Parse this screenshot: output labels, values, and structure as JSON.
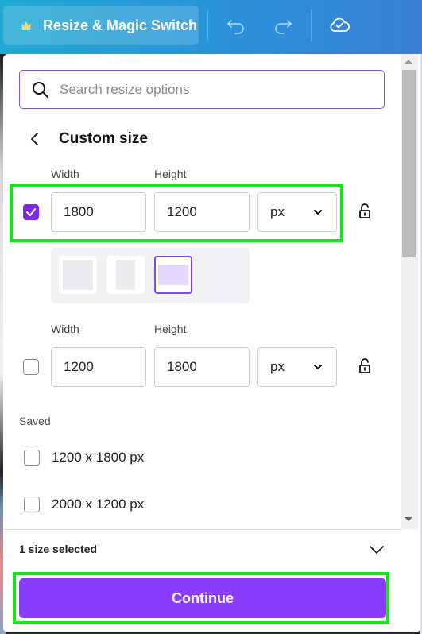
{
  "topbar": {
    "resize_button_label": "Resize & Magic Switch",
    "icons": [
      "crown-icon",
      "undo-icon",
      "redo-icon",
      "cloud-saved-icon"
    ]
  },
  "search": {
    "placeholder": "Search resize options",
    "value": ""
  },
  "custom_size": {
    "title": "Custom size",
    "rows": [
      {
        "width_label": "Width",
        "height_label": "Height",
        "width": "1800",
        "height": "1200",
        "unit": "px",
        "checked": true,
        "locked": false
      },
      {
        "width_label": "Width",
        "height_label": "Height",
        "width": "1200",
        "height": "1800",
        "unit": "px",
        "checked": false,
        "locked": false
      }
    ],
    "orientations": [
      "square",
      "portrait",
      "landscape"
    ],
    "selected_orientation": "landscape"
  },
  "saved": {
    "label": "Saved",
    "items": [
      {
        "label": "1200 x 1800 px",
        "checked": false
      },
      {
        "label": "2000 x 1200 px",
        "checked": false
      }
    ]
  },
  "footer": {
    "selection_text": "1 size selected",
    "continue_label": "Continue"
  },
  "colors": {
    "accent": "#8b3dff",
    "checkbox_checked": "#7d2ae8",
    "highlight": "#19e31d",
    "topbar_start": "#1fa9d3",
    "topbar_end": "#3a7fd9"
  }
}
